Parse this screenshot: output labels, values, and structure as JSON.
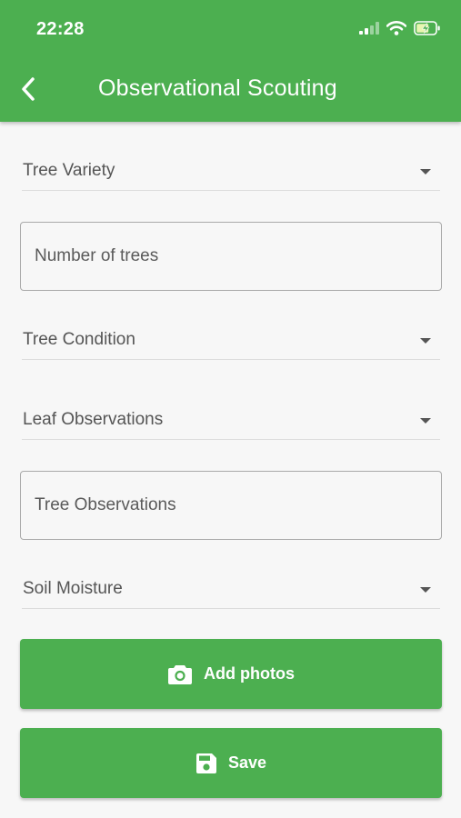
{
  "status_bar": {
    "time": "22:28",
    "icons": [
      "signal-icon",
      "wifi-icon",
      "battery-charging-icon"
    ]
  },
  "app_bar": {
    "title": "Observational Scouting",
    "back_icon": "chevron-left-icon"
  },
  "form": {
    "tree_variety": {
      "label": "Tree Variety"
    },
    "number_of_trees": {
      "placeholder": "Number of trees",
      "value": ""
    },
    "tree_condition": {
      "label": "Tree Condition"
    },
    "leaf_observations": {
      "label": "Leaf Observations"
    },
    "tree_observations": {
      "placeholder": "Tree Observations",
      "value": ""
    },
    "soil_moisture": {
      "label": "Soil Moisture"
    }
  },
  "actions": {
    "add_photos": {
      "label": "Add photos",
      "icon": "camera-icon"
    },
    "save": {
      "label": "Save",
      "icon": "floppy-disk-icon"
    }
  },
  "colors": {
    "primary": "#4caf50",
    "background": "#f7f7f7",
    "text_secondary": "#555555"
  }
}
